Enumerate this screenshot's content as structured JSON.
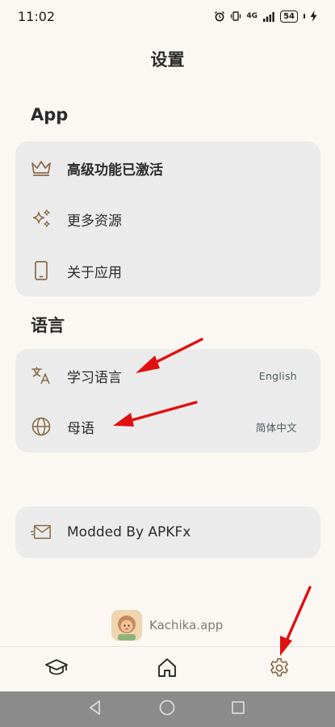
{
  "status_bar": {
    "time": "11:02",
    "network": "4G",
    "battery": "54"
  },
  "page_title": "设置",
  "sections": {
    "app": {
      "title": "App",
      "items": [
        {
          "label": "高级功能已激活",
          "icon": "crown-icon"
        },
        {
          "label": "更多资源",
          "icon": "sparkles-icon"
        },
        {
          "label": "关于应用",
          "icon": "phone-icon"
        }
      ]
    },
    "language": {
      "title": "语言",
      "items": [
        {
          "label": "学习语言",
          "value": "English",
          "icon": "translate-icon"
        },
        {
          "label": "母语",
          "value": "简体中文",
          "icon": "globe-icon"
        }
      ]
    },
    "mod": {
      "label": "Modded By APKFx",
      "icon": "mail-icon"
    }
  },
  "footer": {
    "brand": "Kachika.app"
  },
  "bottom_nav": {
    "items": [
      {
        "icon": "graduation-cap-icon"
      },
      {
        "icon": "home-icon"
      },
      {
        "icon": "gear-icon"
      }
    ]
  },
  "colors": {
    "background": "#fbf8f3",
    "card": "#ebebeb",
    "icon": "#8a6a45",
    "arrow": "#e01010",
    "system_nav": "#8b8b8b"
  }
}
